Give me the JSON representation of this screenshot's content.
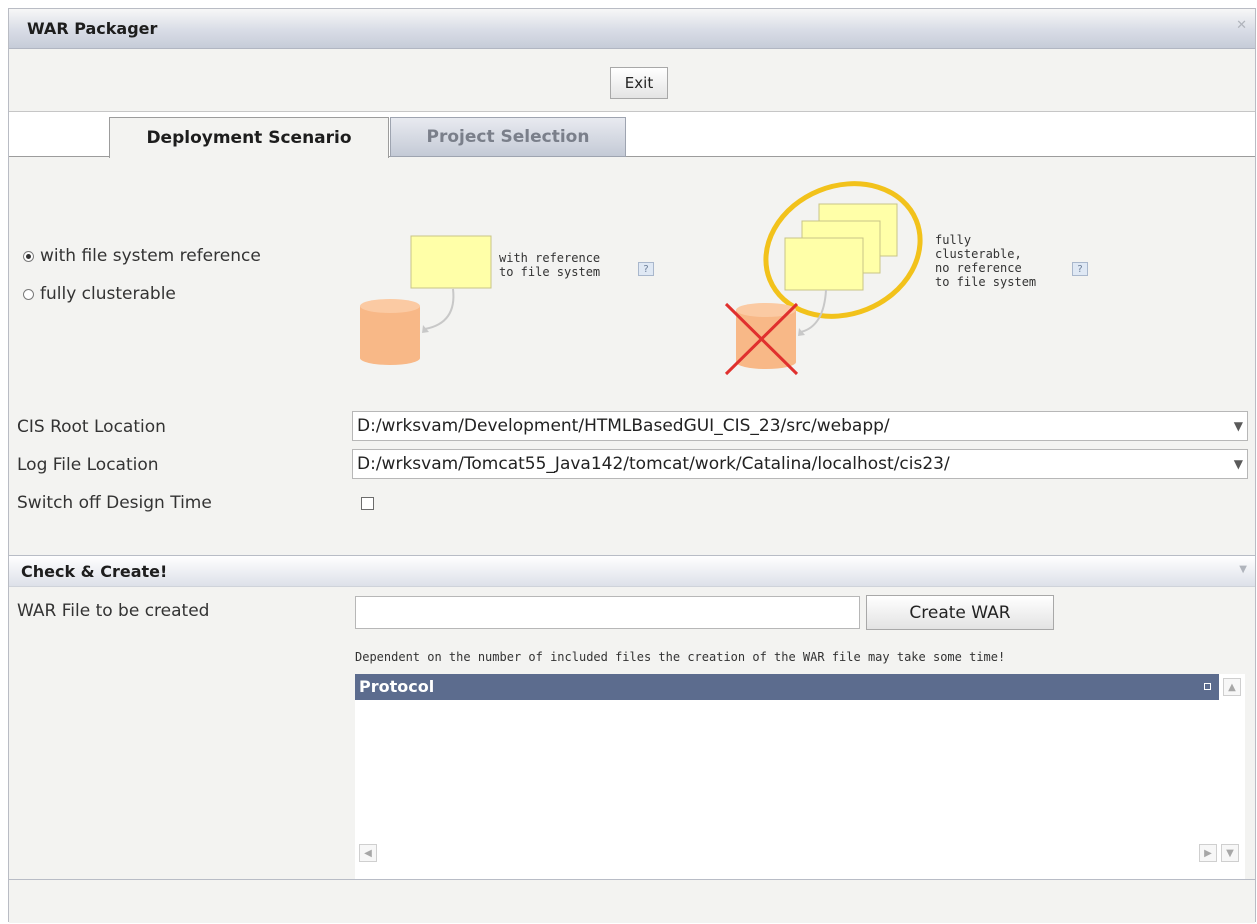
{
  "window": {
    "title": "WAR Packager",
    "close_icon": "close-icon"
  },
  "toolbar": {
    "exit_label": "Exit"
  },
  "tabs": [
    {
      "label": "Deployment Scenario",
      "active": true
    },
    {
      "label": "Project Selection",
      "active": false
    }
  ],
  "scenario": {
    "options": [
      {
        "label": "with file system reference",
        "checked": true
      },
      {
        "label": "fully clusterable",
        "checked": false
      }
    ],
    "diagram_left_caption": "with reference\nto file system",
    "diagram_right_caption": "fully\nclusterable,\nno reference\nto file system",
    "help_label": "?"
  },
  "form": {
    "cis_root_label": "CIS Root Location",
    "cis_root_value": "D:/wrksvam/Development/HTMLBasedGUI_CIS_23/src/webapp/",
    "log_file_label": "Log File Location",
    "log_file_value": "D:/wrksvam/Tomcat55_Java142/tomcat/work/Catalina/localhost/cis23/",
    "design_time_label": "Switch off Design Time",
    "design_time_checked": false
  },
  "check_create": {
    "section_title": "Check & Create!",
    "war_file_label": "WAR File to be created",
    "war_file_value": "",
    "create_button_label": "Create WAR",
    "hint_text": "Dependent on the number of included files the creation of the WAR file may take some time!",
    "protocol_header": "Protocol"
  },
  "colors": {
    "title_gradient_end": "#c6ccd8",
    "protocol_header_bg": "#5c6c8e",
    "note_yellow": "#ffffa8",
    "db_orange": "#f8b887",
    "ellipse_gold": "#f2c21b",
    "cross_red": "#e0302e"
  }
}
